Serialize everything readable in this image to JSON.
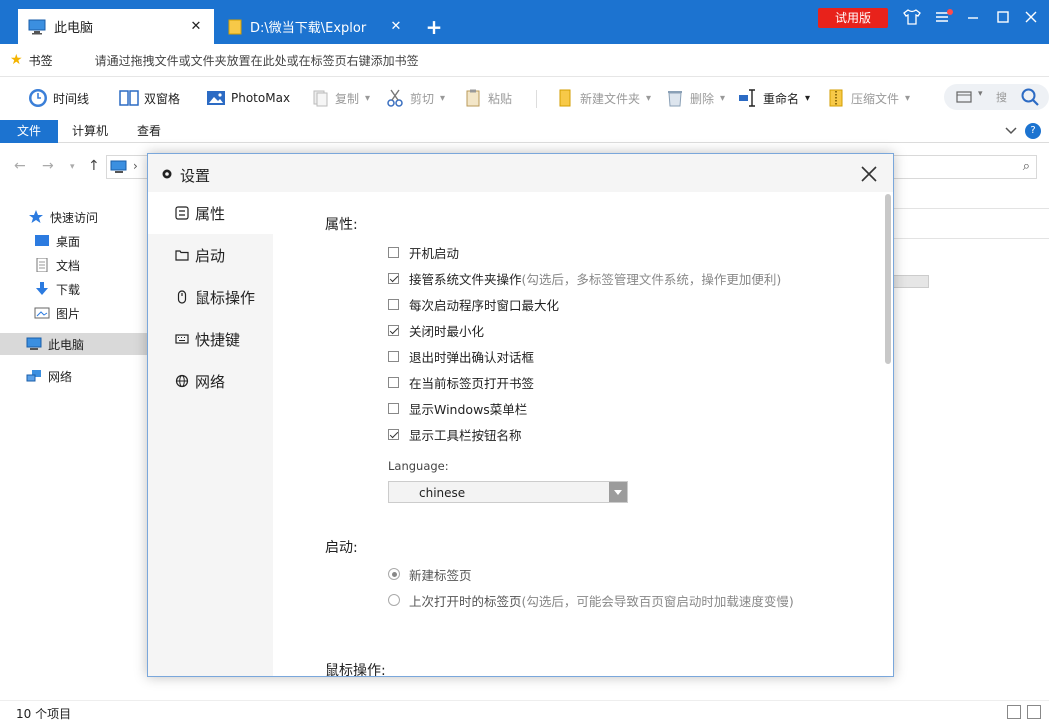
{
  "titlebar": {
    "tabs": [
      {
        "label": "此电脑",
        "active": true
      },
      {
        "label": "D:\\微当下载\\Explor",
        "active": false
      }
    ],
    "new_tab": "+",
    "trial_badge": "试用版",
    "accent": "#1c73d0",
    "trial_color": "#e8221b"
  },
  "bookmarks": {
    "label": "书签",
    "hint": "请通过拖拽文件或文件夹放置在此处或在标签页右键添加书签"
  },
  "toolbar": {
    "timeline": "时间线",
    "dual_pane": "双窗格",
    "photomax": "PhotoMax",
    "copy": "复制",
    "cut": "剪切",
    "paste": "粘贴",
    "new_folder": "新建文件夹",
    "delete": "删除",
    "rename": "重命名",
    "compress": "压缩文件",
    "search_hint": "搜"
  },
  "ribbon": {
    "tabs": [
      "文件",
      "计算机",
      "查看"
    ]
  },
  "sidebar": {
    "items": [
      {
        "label": "快速访问",
        "icon": "star-icon"
      },
      {
        "label": "桌面",
        "icon": "desktop-icon"
      },
      {
        "label": "文档",
        "icon": "document-icon"
      },
      {
        "label": "下载",
        "icon": "download-icon"
      },
      {
        "label": "图片",
        "icon": "picture-icon"
      },
      {
        "label": "此电脑",
        "icon": "computer-icon",
        "selected": true
      },
      {
        "label": "网络",
        "icon": "network-icon"
      }
    ]
  },
  "status": {
    "count": "10 个项目"
  },
  "settings": {
    "title": "设置",
    "nav": [
      {
        "label": "属性",
        "icon": "properties-icon",
        "active": true
      },
      {
        "label": "启动",
        "icon": "folder-icon"
      },
      {
        "label": "鼠标操作",
        "icon": "mouse-icon"
      },
      {
        "label": "快捷键",
        "icon": "keyboard-icon"
      },
      {
        "label": "网络",
        "icon": "globe-icon"
      }
    ],
    "sections": {
      "properties": "属性:",
      "startup": "启动:",
      "mouse": "鼠标操作:"
    },
    "options": [
      {
        "label": "开机启动",
        "hint": "",
        "checked": false
      },
      {
        "label": "接管系统文件夹操作",
        "hint": "(勾选后，多标签管理文件系统，操作更加便利)",
        "checked": true
      },
      {
        "label": "每次启动程序时窗口最大化",
        "hint": "",
        "checked": false
      },
      {
        "label": "关闭时最小化",
        "hint": "",
        "checked": true
      },
      {
        "label": "退出时弹出确认对话框",
        "hint": "",
        "checked": false
      },
      {
        "label": "在当前标签页打开书签",
        "hint": "",
        "checked": false
      },
      {
        "label": "显示Windows菜单栏",
        "hint": "",
        "checked": false
      },
      {
        "label": "显示工具栏按钮名称",
        "hint": "",
        "checked": true
      }
    ],
    "language_label": "Language:",
    "language_value": "chinese",
    "startup_options": [
      {
        "label": "新建标签页",
        "hint": "",
        "selected": true
      },
      {
        "label": "上次打开时的标签页",
        "hint": "(勾选后，可能会导致百页窗启动时加载速度变慢)",
        "selected": false
      }
    ]
  }
}
